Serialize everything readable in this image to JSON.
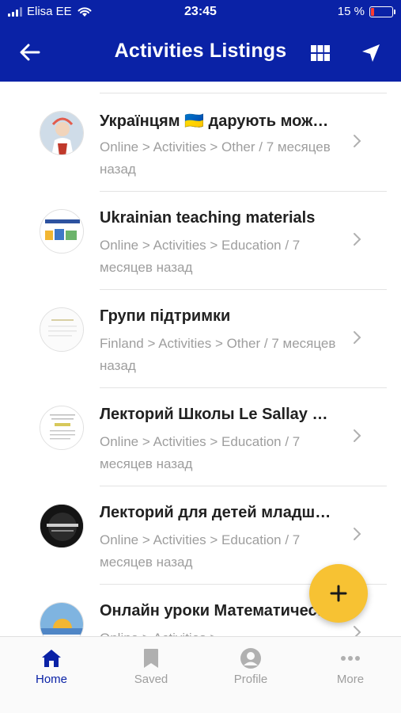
{
  "status_bar": {
    "carrier": "Elisa EE",
    "time": "23:45",
    "battery_percent": "15 %",
    "battery_level": 0.15
  },
  "header": {
    "title": "Activities Listings",
    "back_icon": "arrow-left-icon",
    "grid_icon": "grid-view-icon",
    "nav_icon": "navigation-icon"
  },
  "listings": [
    {
      "title": "Українцям 🇺🇦 дарують можливіст...",
      "meta": "Online > Activities > Other / 7 месяцев назад"
    },
    {
      "title": "Ukrainian teaching materials",
      "meta": "Online > Activities > Education / 7 месяцев назад"
    },
    {
      "title": "Групи підтримки",
      "meta": "Finland > Activities > Other / 7 месяцев назад"
    },
    {
      "title": "Лекторий Школы Le Sallay Диалог",
      "meta": "Online > Activities > Education / 7 месяцев назад"
    },
    {
      "title": "Лекторий для детей младшего, ср...",
      "meta": "Online > Activities > Education / 7 месяцев назад"
    },
    {
      "title": "Онлайн уроки Математического кр...",
      "meta": "Online > Activities >"
    }
  ],
  "fab": {
    "icon": "plus-icon"
  },
  "tabs": [
    {
      "label": "Home",
      "icon": "home-icon",
      "active": true
    },
    {
      "label": "Saved",
      "icon": "bookmark-icon",
      "active": false
    },
    {
      "label": "Profile",
      "icon": "profile-icon",
      "active": false
    },
    {
      "label": "More",
      "icon": "more-dots-icon",
      "active": false
    }
  ],
  "colors": {
    "primary": "#0a22a6",
    "accent": "#f7c233",
    "battery_low": "#ff3b30"
  }
}
